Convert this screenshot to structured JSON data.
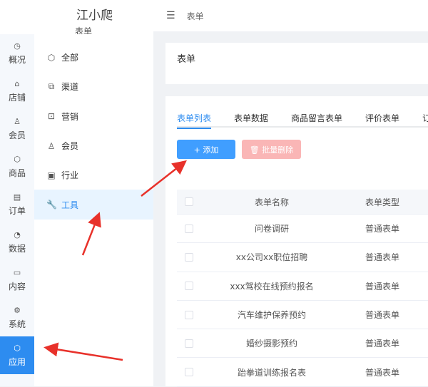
{
  "logo": {
    "title": "江小爬",
    "subtitle": "表单"
  },
  "rail": [
    {
      "icon": "dashboard-icon",
      "glyph": "◷",
      "label": "概况"
    },
    {
      "icon": "store-icon",
      "glyph": "⌂",
      "label": "店铺"
    },
    {
      "icon": "user-icon",
      "glyph": "♙",
      "label": "会员"
    },
    {
      "icon": "box-icon",
      "glyph": "⬡",
      "label": "商品"
    },
    {
      "icon": "clipboard-icon",
      "glyph": "▤",
      "label": "订单"
    },
    {
      "icon": "pie-chart-icon",
      "glyph": "◔",
      "label": "数据"
    },
    {
      "icon": "folder-icon",
      "glyph": "▭",
      "label": "内容"
    },
    {
      "icon": "gear-icon",
      "glyph": "⚙",
      "label": "系统"
    },
    {
      "icon": "app-box-icon",
      "glyph": "⬡",
      "label": "应用"
    }
  ],
  "side": [
    {
      "icon": "cube-icon",
      "glyph": "⬡",
      "label": "全部"
    },
    {
      "icon": "channel-icon",
      "glyph": "⧉",
      "label": "渠道"
    },
    {
      "icon": "marketing-icon",
      "glyph": "⊡",
      "label": "营销"
    },
    {
      "icon": "user-icon",
      "glyph": "♙",
      "label": "会员"
    },
    {
      "icon": "briefcase-icon",
      "glyph": "▣",
      "label": "行业"
    },
    {
      "icon": "wrench-icon",
      "glyph": "🔧",
      "label": "工具"
    }
  ],
  "header": {
    "breadcrumb": "表单",
    "menu_glyph": "☰"
  },
  "card_title": "表单",
  "tabs": [
    "表单列表",
    "表单数据",
    "商品留言表单",
    "评价表单",
    "订"
  ],
  "buttons": {
    "add": "+ 添加",
    "batch_delete": "🗑 批量删除"
  },
  "table": {
    "headers": [
      "表单名称",
      "表单类型"
    ],
    "rows": [
      [
        "问卷调研",
        "普通表单"
      ],
      [
        "xx公司xx职位招聘",
        "普通表单"
      ],
      [
        "xxx驾校在线预约报名",
        "普通表单"
      ],
      [
        "汽车维护保养预约",
        "普通表单"
      ],
      [
        "婚纱摄影预约",
        "普通表单"
      ],
      [
        "跆拳道训练报名表",
        "普通表单"
      ]
    ]
  },
  "colors": {
    "accent": "#2d8cf0",
    "annotation": "#e8312a"
  }
}
